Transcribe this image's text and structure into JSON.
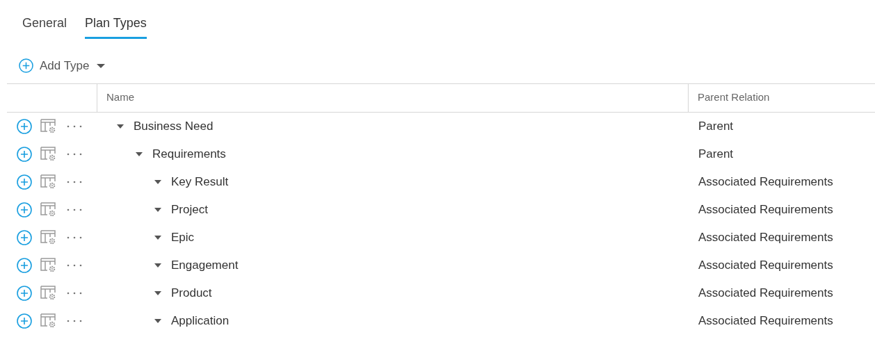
{
  "tabs": [
    {
      "label": "General",
      "selected": false
    },
    {
      "label": "Plan Types",
      "selected": true
    }
  ],
  "add_button": {
    "label": "Add Type"
  },
  "table": {
    "columns": [
      "Name",
      "Parent Relation"
    ],
    "rows": [
      {
        "name": "Business Need",
        "parent_relation": "Parent",
        "expanded": true,
        "children": [
          {
            "name": "Requirements",
            "parent_relation": "Parent",
            "expanded": true,
            "children": [
              {
                "name": "Key Result",
                "parent_relation": "Associated Requirements",
                "expanded": true
              },
              {
                "name": "Project",
                "parent_relation": "Associated Requirements",
                "expanded": true
              },
              {
                "name": "Epic",
                "parent_relation": "Associated Requirements",
                "expanded": true
              },
              {
                "name": "Engagement",
                "parent_relation": "Associated Requirements",
                "expanded": true
              },
              {
                "name": "Product",
                "parent_relation": "Associated Requirements",
                "expanded": true
              },
              {
                "name": "Application",
                "parent_relation": "Associated Requirements",
                "expanded": true
              }
            ]
          }
        ]
      }
    ]
  }
}
